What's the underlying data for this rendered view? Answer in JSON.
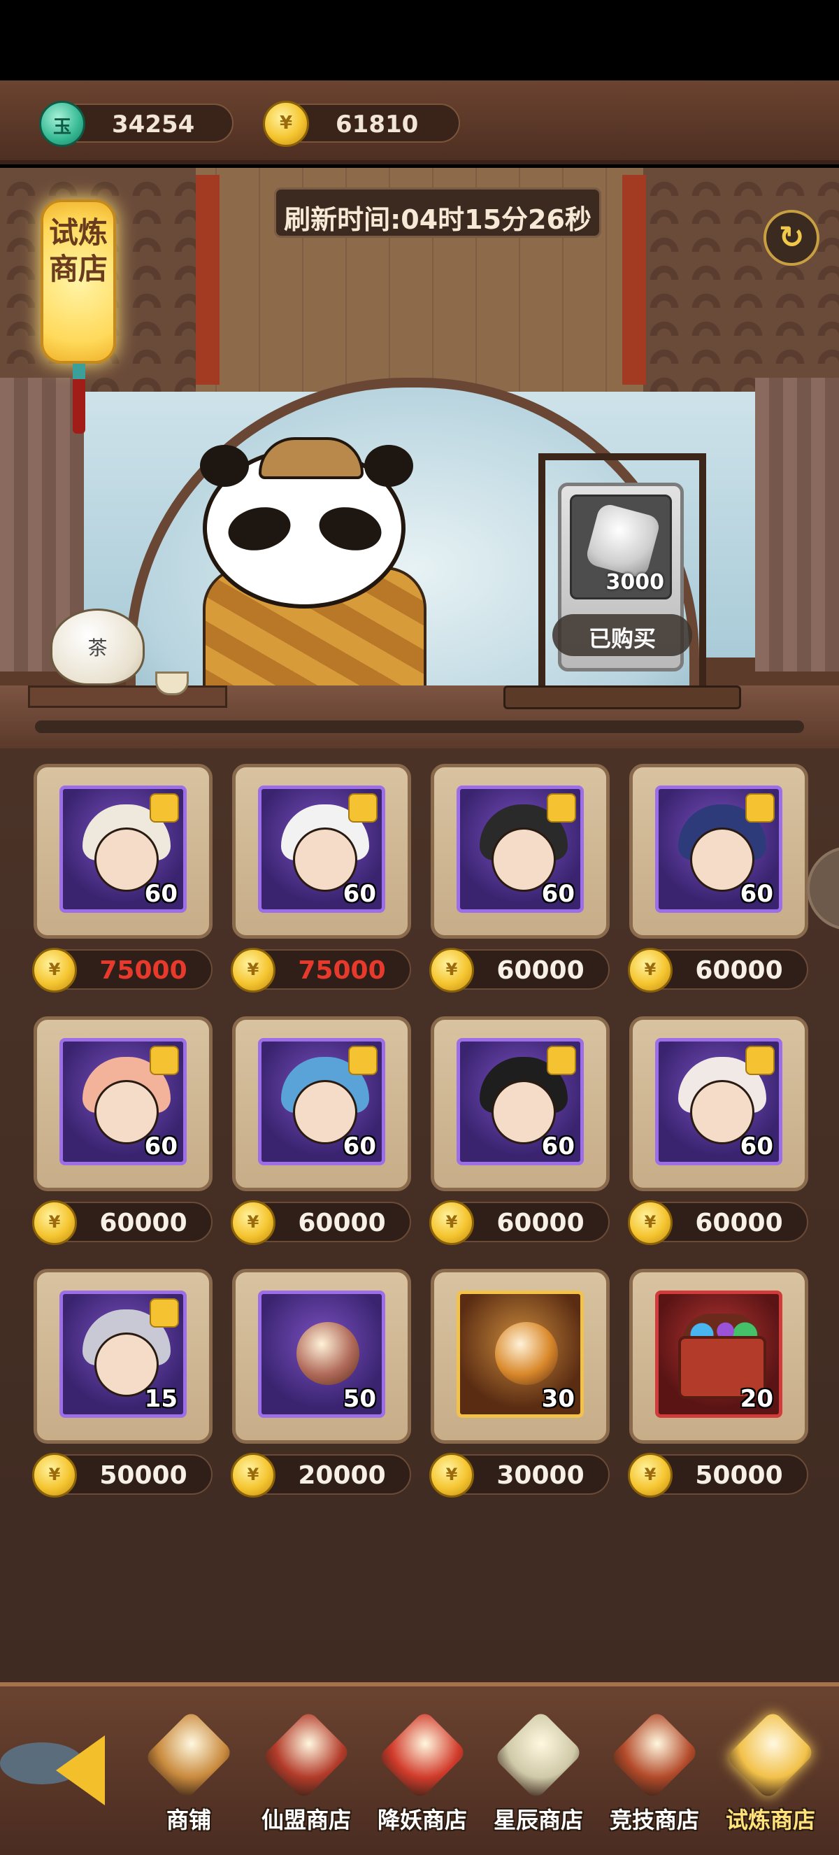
{
  "currencies": [
    {
      "name": "jade",
      "icon": "jade-coin-icon",
      "glyph": "玉",
      "value": "34254"
    },
    {
      "name": "gold",
      "icon": "gold-coin-icon",
      "glyph": "¥",
      "value": "61810"
    }
  ],
  "shop": {
    "title": "试炼\n商店",
    "refresh_text": "刷新时间:04时15分26秒",
    "refresh_button_icon": "refresh-icon",
    "featured": {
      "icon": "silver-ingot-icon",
      "quantity": "3000",
      "status": "已购买"
    }
  },
  "items": [
    {
      "type": "hero-shard",
      "frame": "purple",
      "hair": "#efe8dc",
      "count": "60",
      "price": "75000",
      "price_color": "red"
    },
    {
      "type": "hero-shard",
      "frame": "purple",
      "hair": "#f2f2f2",
      "count": "60",
      "price": "75000",
      "price_color": "red"
    },
    {
      "type": "hero-shard",
      "frame": "purple",
      "hair": "#2a2a2a",
      "count": "60",
      "price": "60000",
      "price_color": "white"
    },
    {
      "type": "hero-shard",
      "frame": "purple",
      "hair": "#2e3b7a",
      "count": "60",
      "price": "60000",
      "price_color": "white"
    },
    {
      "type": "hero-shard",
      "frame": "purple",
      "hair": "#f3b39a",
      "count": "60",
      "price": "60000",
      "price_color": "white"
    },
    {
      "type": "hero-shard",
      "frame": "purple",
      "hair": "#5aa3d8",
      "count": "60",
      "price": "60000",
      "price_color": "white"
    },
    {
      "type": "hero-shard",
      "frame": "purple",
      "hair": "#1e1e1e",
      "count": "60",
      "price": "60000",
      "price_color": "white"
    },
    {
      "type": "hero-shard",
      "frame": "purple",
      "hair": "#f1e9e6",
      "count": "60",
      "price": "60000",
      "price_color": "white"
    },
    {
      "type": "hero-shard",
      "frame": "purple",
      "hair": "#c9c9d6",
      "count": "15",
      "price": "50000",
      "price_color": "white"
    },
    {
      "type": "token",
      "frame": "purple",
      "coin": "#b06a5a",
      "count": "50",
      "price": "20000",
      "price_color": "white"
    },
    {
      "type": "token",
      "frame": "gold",
      "coin": "#d9882a",
      "count": "30",
      "price": "30000",
      "price_color": "white"
    },
    {
      "type": "chest",
      "frame": "red",
      "count": "20",
      "price": "50000",
      "price_color": "white"
    }
  ],
  "nav": {
    "back_icon": "back-arrow-icon",
    "tabs": [
      {
        "label": "商铺",
        "icon": "panda-shop-icon",
        "color": "#c98a3d"
      },
      {
        "label": "仙盟商店",
        "icon": "alliance-banner-icon",
        "color": "#b33b2a"
      },
      {
        "label": "降妖商店",
        "icon": "demon-scroll-icon",
        "color": "#d23b2b"
      },
      {
        "label": "星辰商店",
        "icon": "star-pagoda-icon",
        "color": "#cfc9a8"
      },
      {
        "label": "竞技商店",
        "icon": "arena-sword-icon",
        "color": "#b34a2a"
      },
      {
        "label": "试炼商店",
        "icon": "trial-shop-icon",
        "color": "#f2c14a",
        "active": true
      }
    ]
  }
}
